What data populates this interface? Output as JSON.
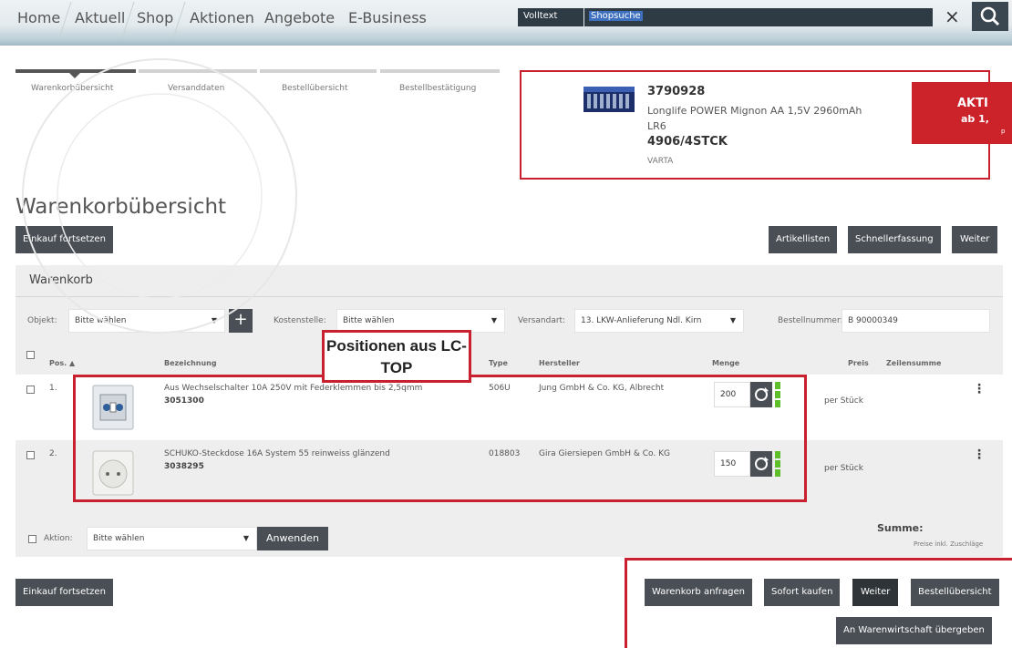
{
  "nav": {
    "items": [
      "Home",
      "Aktuell",
      "Shop",
      "Aktionen",
      "Angebote",
      "E-Business"
    ],
    "search_mode": "Volltext",
    "search_value": "Shopsuche",
    "close_glyph": "×",
    "search_icon": "search-icon"
  },
  "steps": [
    "Warenkorbübersicht",
    "Versanddaten",
    "Bestellübersicht",
    "Bestellbestätigung"
  ],
  "promo": {
    "number": "3790928",
    "description": "Longlife POWER Mignon AA 1,5V 2960mAh LR6",
    "code": "4906/4STCK",
    "brand": "VARTA",
    "badge_title": "AKTI",
    "badge_sub": "ab 1,",
    "badge_note": "p"
  },
  "page_title": "Warenkorbübersicht",
  "buttons": {
    "continue_shopping": "Einkauf fortsetzen",
    "article_lists": "Artikellisten",
    "quick_entry": "Schnellerfassung",
    "next": "Weiter"
  },
  "cart": {
    "title": "Warenkorb",
    "object_label": "Objekt:",
    "object_value": "Bitte wählen",
    "cost_label": "Kostenstelle:",
    "cost_value": "Bitte wählen",
    "shipping_label": "Versandart:",
    "shipping_value": "13. LKW-Anlieferung Ndl. Kirn",
    "order_label": "Bestellnummer:",
    "order_value": "B 90000349",
    "headers": {
      "pos": "Pos. ▲",
      "name": "Bezeichnung",
      "type": "Type",
      "maker": "Hersteller",
      "qty": "Menge",
      "price": "Preis",
      "line_sum": "Zeilensumme"
    },
    "rows": [
      {
        "pos": "1.",
        "name": "Aus Wechselschalter 10A 250V mit Federklemmen bis 2,5qmm",
        "number": "3051300",
        "type": "506U",
        "maker": "Jung GmbH & Co. KG, Albrecht",
        "qty": "200",
        "unit": "per Stück",
        "image": "switch-image"
      },
      {
        "pos": "2.",
        "name": "SCHUKO-Steckdose 16A System 55 reinweiss glänzend",
        "number": "3038295",
        "type": "018803",
        "maker": "Gira Giersiepen GmbH & Co. KG",
        "qty": "150",
        "unit": "per Stück",
        "image": "socket-image"
      }
    ],
    "action_label": "Aktion:",
    "action_value": "Bitte wählen",
    "apply": "Anwenden",
    "sum_label": "Summe:",
    "sum_note": "Preise inkl. Zuschläge"
  },
  "bottom_buttons": {
    "continue_shopping": "Einkauf fortsetzen",
    "request_cart": "Warenkorb anfragen",
    "buy_now": "Sofort kaufen",
    "next": "Weiter",
    "order_overview": "Bestellübersicht",
    "transfer": "An Warenwirtschaft übergeben"
  },
  "annotation": {
    "callout": "Positionen aus LC-TOP"
  },
  "colors": {
    "accent_red": "#c8202f",
    "button_dark": "#4a4f55",
    "stock_green": "#5fbf2a",
    "highlight_blue": "#3d6fbe"
  }
}
